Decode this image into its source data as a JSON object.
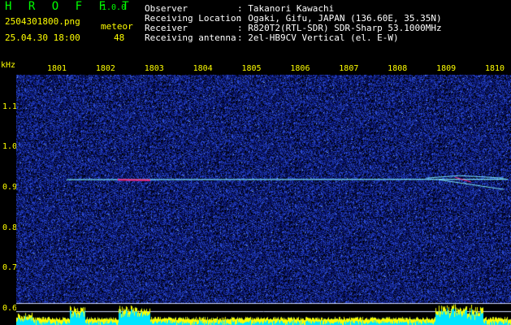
{
  "header": {
    "app_title": "H R O F F T",
    "version": "1.0.0",
    "file_name": "2504301800.png",
    "date_time": "25.04.30 18:00",
    "meteor_label": "meteor",
    "meteor_count": "48"
  },
  "station": [
    {
      "label": "Observer",
      "value": ": Takanori Kawachi"
    },
    {
      "label": "Receiving Location",
      "value": ": Ogaki, Gifu, JAPAN (136.60E, 35.35N)"
    },
    {
      "label": "Receiver",
      "value": ": R820T2(RTL-SDR) SDR-Sharp 53.1000MHz"
    },
    {
      "label": "Receiving antenna",
      "value": ": 2el-HB9CV Vertical (el. E-W)"
    }
  ],
  "chart_data": {
    "type": "heatmap",
    "yunit": "kHz",
    "xticks": [
      "1801",
      "1802",
      "1803",
      "1804",
      "1805",
      "1806",
      "1807",
      "1808",
      "1809",
      "1810"
    ],
    "yticks": [
      "1.1",
      "1.0",
      "0.9",
      "0.8",
      "0.7",
      "0.6"
    ],
    "ylim": [
      0.56,
      1.18
    ],
    "carrier_khz": 0.92,
    "colors": {
      "background": "#000000",
      "noise": "#1a2fa8",
      "trace": "#7fe8ff",
      "trace_hot": "#ff2a7f",
      "spectrum": "#00e5ff",
      "spectrum_peak": "#ffff00",
      "grid": "#cfd8ff",
      "text": "#ffff00"
    }
  }
}
